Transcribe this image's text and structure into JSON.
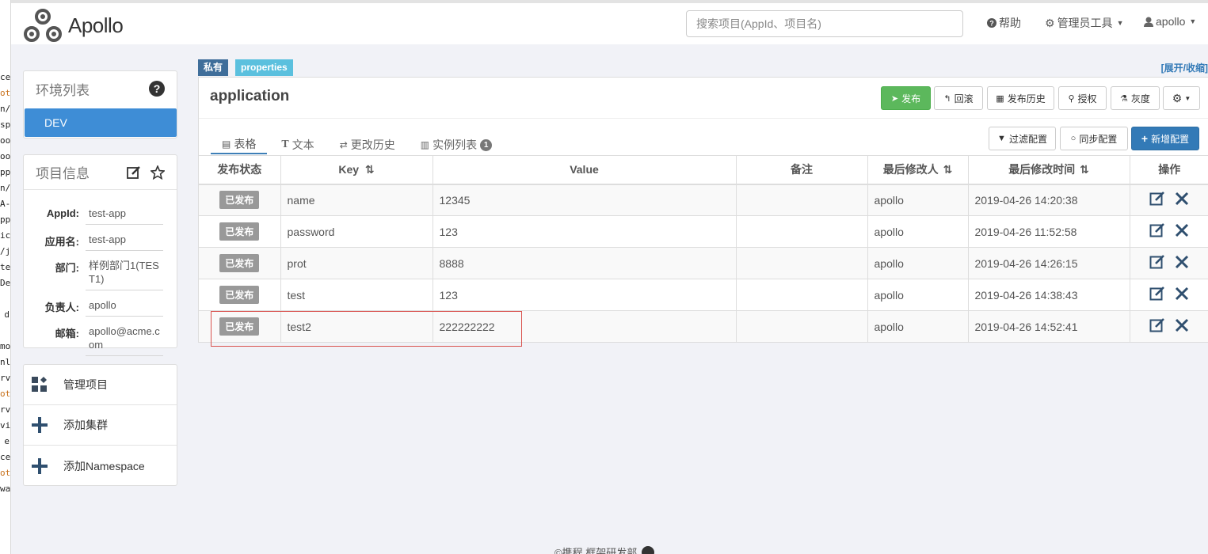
{
  "left_strip": [
    {
      "text": "ce",
      "orange": false
    },
    {
      "text": "ot",
      "orange": true
    },
    {
      "text": "n/",
      "orange": false
    },
    {
      "text": "sp",
      "orange": false
    },
    {
      "text": "oo",
      "orange": false
    },
    {
      "text": "oo",
      "orange": false
    },
    {
      "text": "pp",
      "orange": false
    },
    {
      "text": "n/",
      "orange": false
    },
    {
      "text": "A-",
      "orange": false
    },
    {
      "text": "pp",
      "orange": false
    },
    {
      "text": "ica",
      "orange": false
    },
    {
      "text": "/ja",
      "orange": false
    },
    {
      "text": "ter",
      "orange": false
    },
    {
      "text": "De",
      "orange": false
    },
    {
      "text": "",
      "orange": false
    },
    {
      "text": "d",
      "orange": false
    },
    {
      "text": "",
      "orange": false
    },
    {
      "text": "mo",
      "orange": false
    },
    {
      "text": "nl",
      "orange": false
    },
    {
      "text": "rve",
      "orange": false
    },
    {
      "text": "ot]",
      "orange": true
    },
    {
      "text": "rvi",
      "orange": false
    },
    {
      "text": "vic",
      "orange": false
    },
    {
      "text": "e",
      "orange": false
    },
    {
      "text": "ce",
      "orange": false
    },
    {
      "text": "ot]",
      "orange": true
    },
    {
      "text": "way",
      "orange": false
    }
  ],
  "nav": {
    "logo_text": "Apollo",
    "search_placeholder": "搜索项目(AppId、项目名)",
    "help": "帮助",
    "admin_tools": "管理员工具",
    "user": "apollo"
  },
  "env_panel": {
    "title": "环境列表",
    "envs": [
      "DEV"
    ]
  },
  "project_info": {
    "title": "项目信息",
    "rows": [
      {
        "label": "AppId:",
        "value": "test-app"
      },
      {
        "label": "应用名:",
        "value": "test-app"
      },
      {
        "label": "部门:",
        "value": "样例部门1(TEST1)"
      },
      {
        "label": "负责人:",
        "value": "apollo"
      },
      {
        "label": "邮箱:",
        "value": "apollo@acme.com"
      }
    ]
  },
  "actions": {
    "manage_project": "管理项目",
    "add_cluster": "添加集群",
    "add_namespace": "添加Namespace"
  },
  "namespace": {
    "tag_private": "私有",
    "tag_format": "properties",
    "toggle": "[展开/收缩]",
    "name": "application",
    "buttons": {
      "publish": "发布",
      "rollback": "回滚",
      "history": "发布历史",
      "grant": "授权",
      "gray": "灰度"
    },
    "tabs": {
      "table": "表格",
      "text": "文本",
      "change_history": "更改历史",
      "instances": "实例列表",
      "instances_count": "1"
    },
    "toolbar": {
      "filter": "过滤配置",
      "sync": "同步配置",
      "add": "新增配置"
    },
    "columns": {
      "status": "发布状态",
      "key": "Key",
      "value": "Value",
      "comment": "备注",
      "modifier": "最后修改人",
      "modified_time": "最后修改时间",
      "ops": "操作"
    },
    "rows": [
      {
        "status": "已发布",
        "key": "name",
        "value": "12345",
        "comment": "",
        "modifier": "apollo",
        "time": "2019-04-26 14:20:38"
      },
      {
        "status": "已发布",
        "key": "password",
        "value": "123",
        "comment": "",
        "modifier": "apollo",
        "time": "2019-04-26 11:52:58"
      },
      {
        "status": "已发布",
        "key": "prot",
        "value": "8888",
        "comment": "",
        "modifier": "apollo",
        "time": "2019-04-26 14:26:15"
      },
      {
        "status": "已发布",
        "key": "test",
        "value": "123",
        "comment": "",
        "modifier": "apollo",
        "time": "2019-04-26 14:38:43"
      },
      {
        "status": "已发布",
        "key": "test2",
        "value": "222222222",
        "comment": "",
        "modifier": "apollo",
        "time": "2019-04-26 14:52:41"
      }
    ]
  },
  "footer": {
    "text": "©携程 框架研发部"
  },
  "colors": {
    "brand_blue": "#3e8dd6",
    "success": "#5cb85c",
    "primary": "#337ab7",
    "highlight": "#d9534f"
  }
}
